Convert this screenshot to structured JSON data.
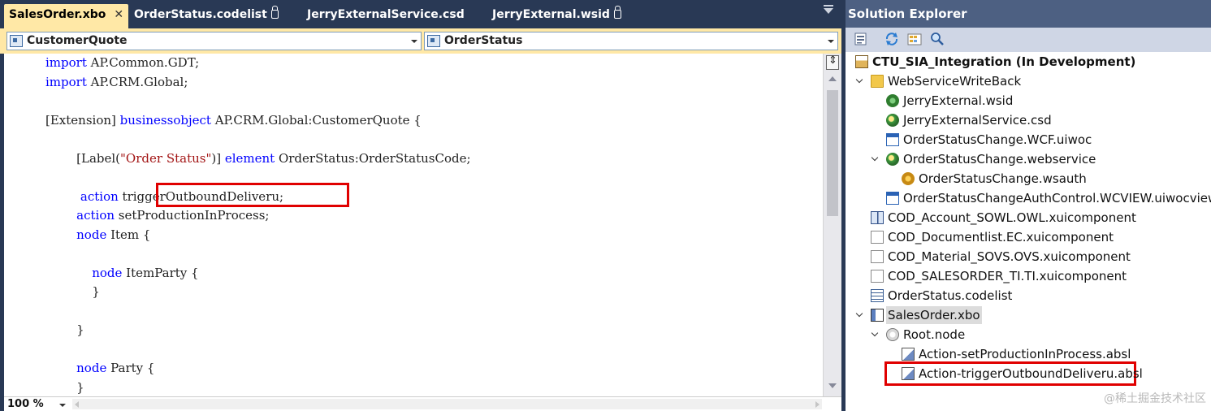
{
  "editor": {
    "tabs": [
      {
        "label": "SalesOrder.xbo",
        "active": true,
        "locked": false
      },
      {
        "label": "OrderStatus.codelist",
        "active": false,
        "locked": true
      },
      {
        "label": "JerryExternalService.csd",
        "active": false,
        "locked": false
      },
      {
        "label": "JerryExternal.wsid",
        "active": false,
        "locked": true
      }
    ],
    "close_glyph": "✕",
    "nav_left": "CustomerQuote",
    "nav_right": "OrderStatus",
    "code_lines": [
      {
        "tokens": [
          {
            "t": "import",
            "c": "kw"
          },
          {
            "t": " AP.Common.GDT;",
            "c": ""
          }
        ]
      },
      {
        "tokens": [
          {
            "t": "import",
            "c": "kw"
          },
          {
            "t": " AP.CRM.Global;",
            "c": ""
          }
        ]
      },
      {
        "tokens": []
      },
      {
        "tokens": [
          {
            "t": "[Extension] ",
            "c": ""
          },
          {
            "t": "businessobject",
            "c": "kw"
          },
          {
            "t": " AP.CRM.Global:CustomerQuote {",
            "c": ""
          }
        ]
      },
      {
        "tokens": []
      },
      {
        "tokens": [
          {
            "t": "        [Label(",
            "c": ""
          },
          {
            "t": "\"Order Status\"",
            "c": "str"
          },
          {
            "t": ")] ",
            "c": ""
          },
          {
            "t": "element",
            "c": "kw"
          },
          {
            "t": " OrderStatus:OrderStatusCode;",
            "c": ""
          }
        ]
      },
      {
        "tokens": []
      },
      {
        "tokens": [
          {
            "t": "         action",
            "c": "kw"
          },
          {
            "t": " triggerOutboundDeliveru;",
            "c": ""
          }
        ]
      },
      {
        "tokens": [
          {
            "t": "        action",
            "c": "kw"
          },
          {
            "t": " setProductionInProcess;",
            "c": ""
          }
        ]
      },
      {
        "tokens": [
          {
            "t": "        node",
            "c": "kw"
          },
          {
            "t": " Item {",
            "c": ""
          }
        ]
      },
      {
        "tokens": []
      },
      {
        "tokens": [
          {
            "t": "            node",
            "c": "kw"
          },
          {
            "t": " ItemParty {",
            "c": ""
          }
        ]
      },
      {
        "tokens": [
          {
            "t": "            }",
            "c": ""
          }
        ]
      },
      {
        "tokens": []
      },
      {
        "tokens": [
          {
            "t": "        }",
            "c": ""
          }
        ]
      },
      {
        "tokens": []
      },
      {
        "tokens": [
          {
            "t": "        node",
            "c": "kw"
          },
          {
            "t": " Party {",
            "c": ""
          }
        ]
      },
      {
        "tokens": [
          {
            "t": "        }",
            "c": ""
          }
        ]
      }
    ],
    "zoom": "100 %"
  },
  "solution_explorer": {
    "title": "Solution Explorer",
    "toolbar_icons": [
      "properties-icon",
      "refresh-icon",
      "show-all-files-icon",
      "search-icon"
    ],
    "tree": [
      {
        "label": "CTU_SIA_Integration (In Development)",
        "icon": "project-icon",
        "level": 0,
        "expander": "none",
        "bold": true
      },
      {
        "label": "WebServiceWriteBack",
        "icon": "folder-icon",
        "level": 1,
        "expander": "expanded"
      },
      {
        "label": "JerryExternal.wsid",
        "icon": "wsid-icon",
        "level": 2,
        "expander": "none"
      },
      {
        "label": "JerryExternalService.csd",
        "icon": "csd-icon",
        "level": 2,
        "expander": "none"
      },
      {
        "label": "OrderStatusChange.WCF.uiwoc",
        "icon": "uiwoc-icon",
        "level": 2,
        "expander": "none"
      },
      {
        "label": "OrderStatusChange.webservice",
        "icon": "webservice-icon",
        "level": 2,
        "expander": "expanded"
      },
      {
        "label": "OrderStatusChange.wsauth",
        "icon": "wsauth-icon",
        "level": 3,
        "expander": "none"
      },
      {
        "label": "OrderStatusChangeAuthControl.WCVIEW.uiwocview",
        "icon": "uiwocview-icon",
        "level": 2,
        "expander": "none"
      },
      {
        "label": "COD_Account_SOWL.OWL.xuicomponent",
        "icon": "xuicomponent-icon",
        "level": 1,
        "expander": "none"
      },
      {
        "label": "COD_Documentlist.EC.xuicomponent",
        "icon": "file-icon",
        "level": 1,
        "expander": "none"
      },
      {
        "label": "COD_Material_SOVS.OVS.xuicomponent",
        "icon": "file-icon",
        "level": 1,
        "expander": "none"
      },
      {
        "label": "COD_SALESORDER_TI.TI.xuicomponent",
        "icon": "file-icon",
        "level": 1,
        "expander": "none"
      },
      {
        "label": "OrderStatus.codelist",
        "icon": "codelist-icon",
        "level": 1,
        "expander": "none"
      },
      {
        "label": "SalesOrder.xbo",
        "icon": "xbo-icon",
        "level": 1,
        "expander": "expanded",
        "selected": true
      },
      {
        "label": "Root.node",
        "icon": "node-icon",
        "level": 2,
        "expander": "expanded"
      },
      {
        "label": "Action-setProductionInProcess.absl",
        "icon": "absl-icon",
        "level": 3,
        "expander": "none"
      },
      {
        "label": "Action-triggerOutboundDeliveru.absl",
        "icon": "absl-icon",
        "level": 3,
        "expander": "none"
      }
    ],
    "watermark": "@稀土掘金技术社区"
  },
  "colors": {
    "chrome_dark": "#293955",
    "active_tab": "#ffe8a6",
    "keyword": "#0000ff",
    "string": "#a31515",
    "highlight_box": "#e00000"
  }
}
